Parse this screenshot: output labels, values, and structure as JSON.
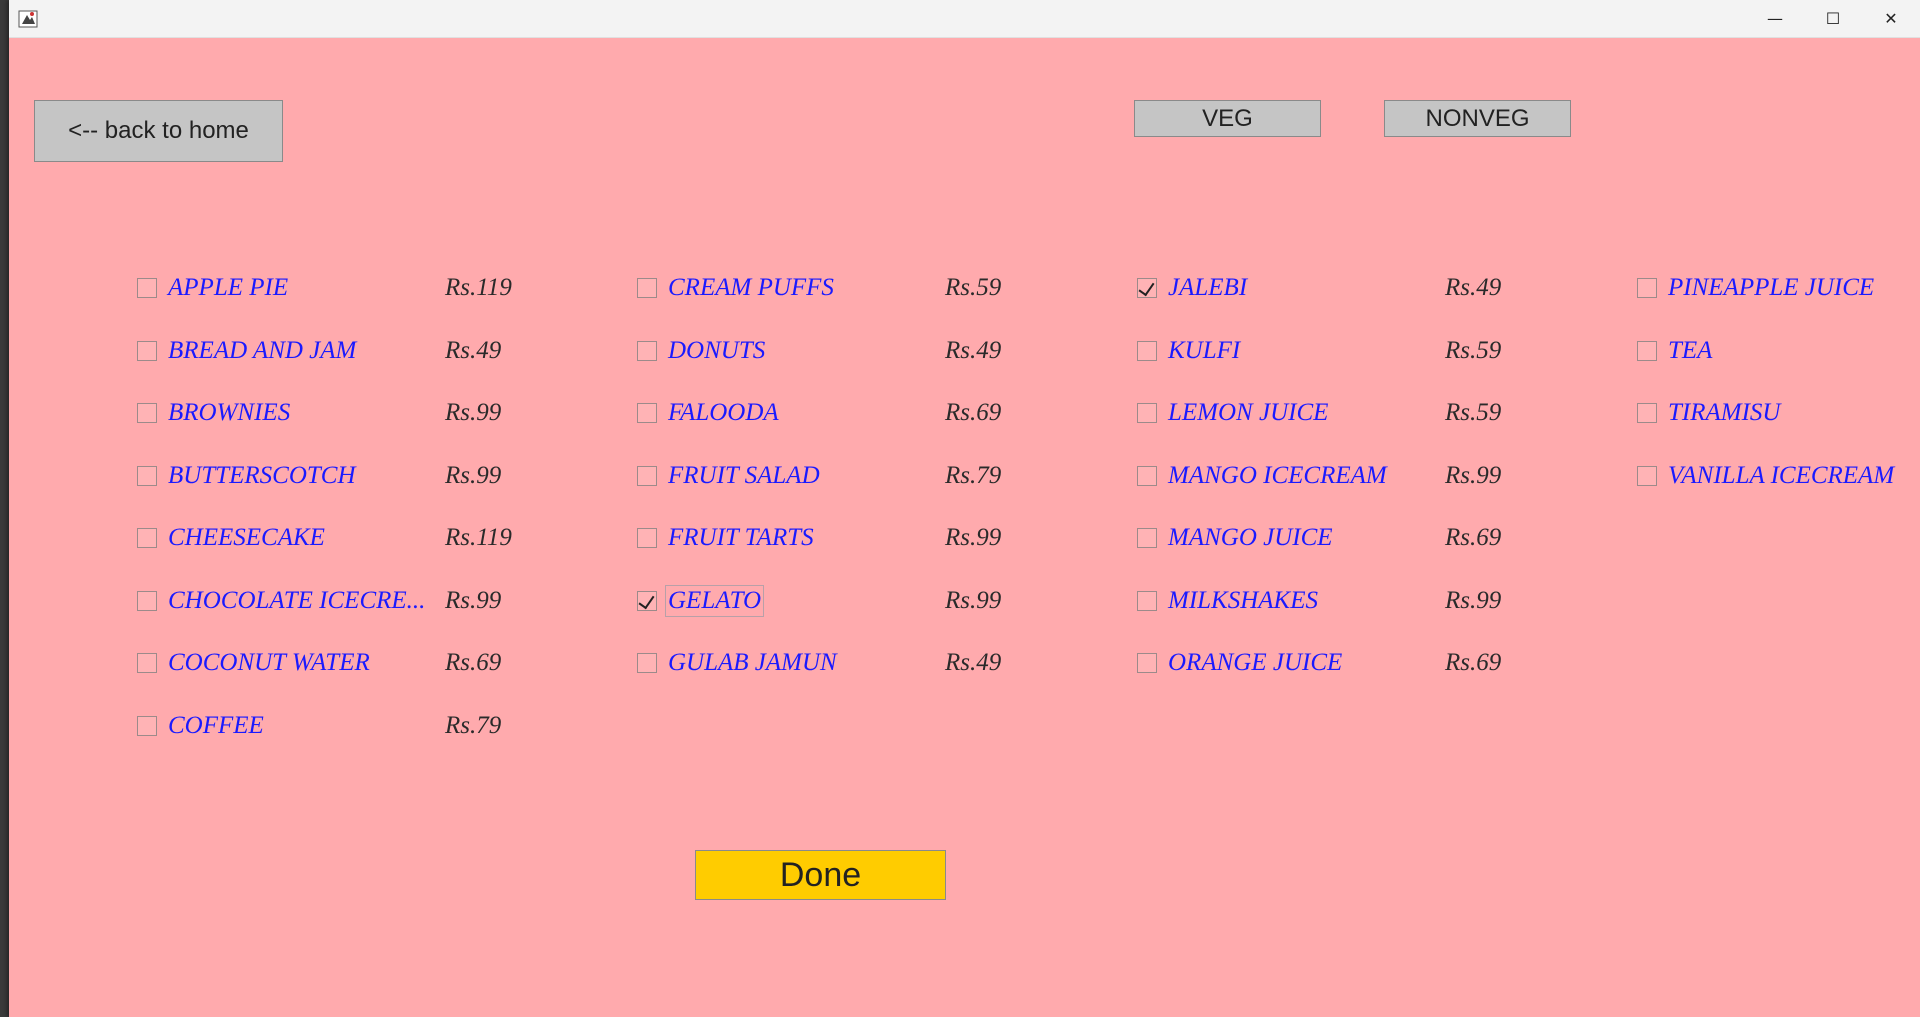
{
  "window": {
    "controls": {
      "minimize": "—",
      "maximize": "☐",
      "close": "✕"
    }
  },
  "toolbar": {
    "back_label": "<-- back to home",
    "veg_label": "VEG",
    "nonveg_label": "NONVEG"
  },
  "menu": {
    "columns": [
      [
        {
          "name": "APPLE PIE",
          "price": "Rs.119",
          "checked": false
        },
        {
          "name": "BREAD AND JAM",
          "price": "Rs.49",
          "checked": false
        },
        {
          "name": "BROWNIES",
          "price": "Rs.99",
          "checked": false
        },
        {
          "name": "BUTTERSCOTCH",
          "price": "Rs.99",
          "checked": false
        },
        {
          "name": "CHEESECAKE",
          "price": "Rs.119",
          "checked": false
        },
        {
          "name": "CHOCOLATE ICECRE...",
          "price": "Rs.99",
          "checked": false
        },
        {
          "name": "COCONUT WATER",
          "price": "Rs.69",
          "checked": false
        },
        {
          "name": "COFFEE",
          "price": "Rs.79",
          "checked": false
        }
      ],
      [
        {
          "name": "CREAM PUFFS",
          "price": "Rs.59",
          "checked": false
        },
        {
          "name": "DONUTS",
          "price": "Rs.49",
          "checked": false
        },
        {
          "name": "FALOODA",
          "price": "Rs.69",
          "checked": false
        },
        {
          "name": "FRUIT SALAD",
          "price": "Rs.79",
          "checked": false
        },
        {
          "name": "FRUIT TARTS",
          "price": "Rs.99",
          "checked": false
        },
        {
          "name": "GELATO",
          "price": "Rs.99",
          "checked": true,
          "focused": true
        },
        {
          "name": "GULAB JAMUN",
          "price": "Rs.49",
          "checked": false
        }
      ],
      [
        {
          "name": "JALEBI",
          "price": "Rs.49",
          "checked": true
        },
        {
          "name": "KULFI",
          "price": "Rs.59",
          "checked": false
        },
        {
          "name": "LEMON JUICE",
          "price": "Rs.59",
          "checked": false
        },
        {
          "name": "MANGO ICECREAM",
          "price": "Rs.99",
          "checked": false
        },
        {
          "name": "MANGO JUICE",
          "price": "Rs.69",
          "checked": false
        },
        {
          "name": "MILKSHAKES",
          "price": "Rs.99",
          "checked": false
        },
        {
          "name": "ORANGE JUICE",
          "price": "Rs.69",
          "checked": false
        }
      ],
      [
        {
          "name": "PINEAPPLE JUICE",
          "price": "",
          "checked": false
        },
        {
          "name": "TEA",
          "price": "",
          "checked": false
        },
        {
          "name": "TIRAMISU",
          "price": "",
          "checked": false
        },
        {
          "name": "VANILLA ICECREAM",
          "price": "",
          "checked": false
        }
      ]
    ]
  },
  "footer": {
    "done_label": "Done"
  },
  "colors": {
    "background": "#ffaaad",
    "item_text": "#1a1aff",
    "done_button": "#ffcc00",
    "gray_button": "#c5c5c5"
  }
}
